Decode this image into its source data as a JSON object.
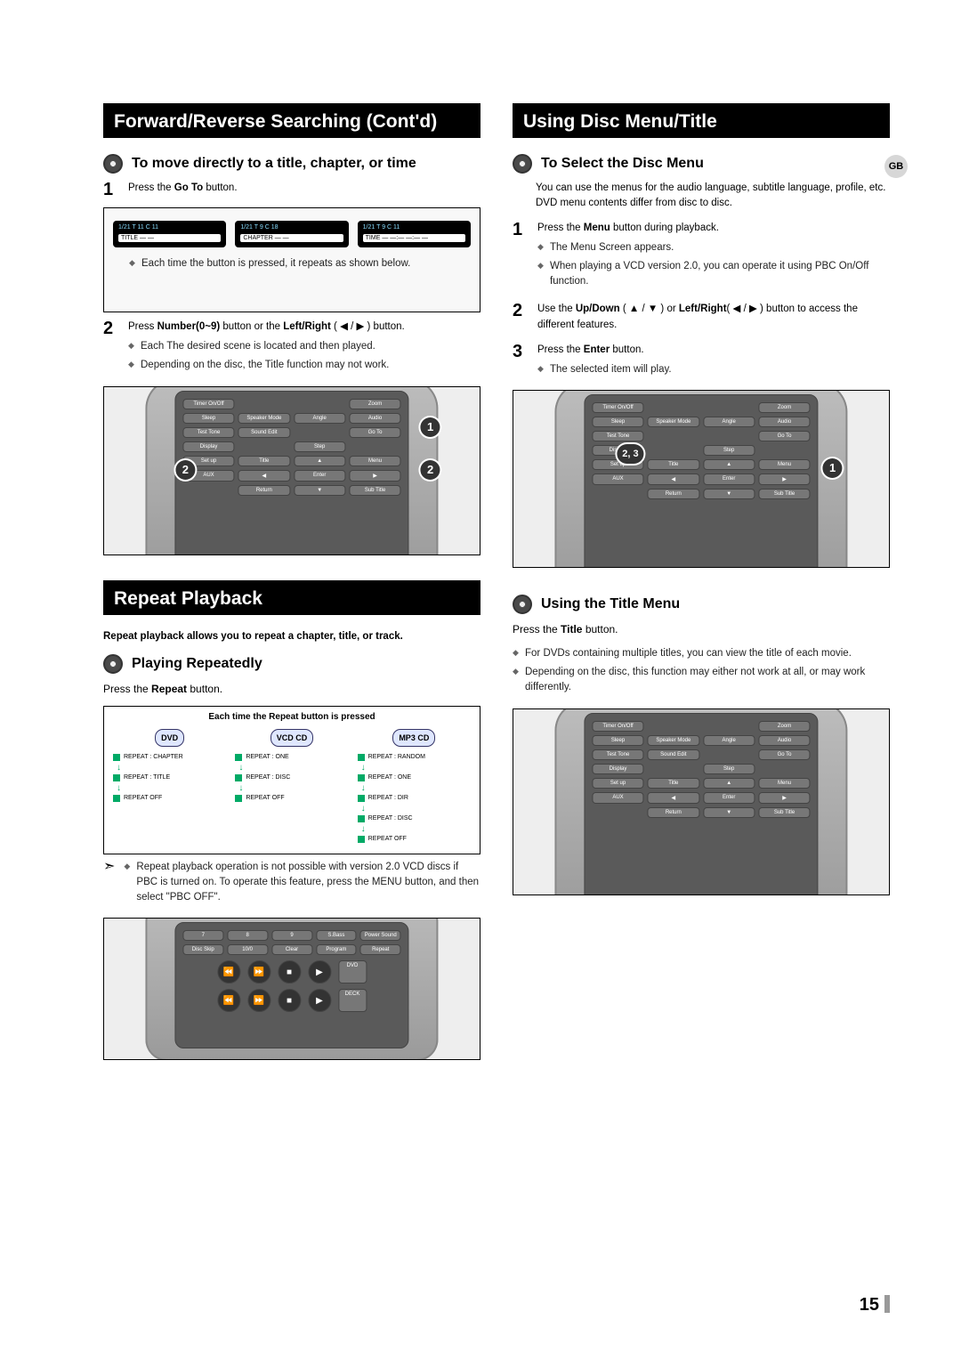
{
  "gb_label": "GB",
  "page_number": "15",
  "left": {
    "band1": "Forward/Reverse Searching (Cont'd)",
    "heading1": "To move directly to a title, chapter, or time",
    "step1_num": "1",
    "step1_text_a": "Press the ",
    "step1_text_bold": "Go To",
    "step1_text_b": " button.",
    "goto_panels": {
      "p1_top": "1/21  T 11  C 11",
      "p1_bot": "TITLE   — —",
      "p2_top": "1/21  T 9  C 18",
      "p2_bot": "CHAPTER — —",
      "p3_top": "1/21  T 9  C 11",
      "p3_bot": "TIME — —:— —:— —"
    },
    "step1_note": "Each time the button is pressed, it repeats as shown below.",
    "step2_num": "2",
    "step2_text_a": "Press ",
    "step2_bold_a": "Number(0~9)",
    "step2_text_b": " button or the ",
    "step2_bold_b": "Left/Right",
    "step2_text_c": " ( ◀ / ▶ ) button.",
    "step2_note1": "Each The desired scene is located and then played.",
    "step2_note2": "Depending on the disc, the Title function may not work.",
    "remote1": {
      "rows": [
        [
          "Timer On/Off",
          "",
          "",
          "Zoom"
        ],
        [
          "Sleep",
          "Speaker Mode",
          "Angle",
          "Audio"
        ],
        [
          "Test Tone",
          "Sound Edit",
          "",
          "Go To"
        ],
        [
          "Display",
          "",
          "Step",
          ""
        ],
        [
          "Set up",
          "Title",
          "▲",
          "Menu"
        ],
        [
          "AUX",
          "◀",
          "Enter",
          "▶"
        ],
        [
          "",
          "Return",
          "▼",
          "Sub Title"
        ]
      ],
      "callouts": {
        "c1": "1",
        "c2a": "2",
        "c2b": "2"
      }
    },
    "band2": "Repeat Playback",
    "intro_bold": "Repeat playback allows you to repeat a chapter, title, or track.",
    "heading2": "Playing Repeatedly",
    "press_repeat_a": "Press the ",
    "press_repeat_bold": "Repeat",
    "press_repeat_b": " button.",
    "repeat_title": "Each time the Repeat button is pressed",
    "repeat_cols": {
      "dvd": {
        "badge": "DVD",
        "states": [
          "REPEAT : CHAPTER",
          "REPEAT : TITLE",
          "REPEAT OFF"
        ]
      },
      "vcdcd": {
        "badge": "VCD CD",
        "states": [
          "REPEAT : ONE",
          "REPEAT : DISC",
          "REPEAT OFF"
        ]
      },
      "mp3": {
        "badge": "MP3  CD",
        "states": [
          "REPEAT : RANDOM",
          "REPEAT : ONE",
          "REPEAT : DIR",
          "REPEAT : DISC",
          "REPEAT OFF"
        ]
      }
    },
    "arrow_note": "Repeat playback operation is not possible with version 2.0 VCD discs if PBC is turned on.\nTo operate this feature, press the MENU button, and then select \"PBC OFF\".",
    "remote2": {
      "top_labels": [
        "7",
        "8",
        "9",
        "S.Bass",
        "Power Sound"
      ],
      "mid_labels": [
        "Disc Skip",
        "10/0",
        "Clear",
        "Program",
        "Repeat"
      ],
      "side_labels": [
        "DVD",
        "DECK"
      ]
    }
  },
  "right": {
    "band1": "Using Disc Menu/Title",
    "heading1": "To Select the Disc Menu",
    "intro": "You can use the menus for the audio language, subtitle language, profile, etc. DVD menu contents differ from disc to disc.",
    "step1_num": "1",
    "step1_a": "Press the ",
    "step1_bold": "Menu",
    "step1_b": " button during playback.",
    "step1_note1": "The Menu Screen appears.",
    "step1_note2": "When playing a VCD version 2.0, you can operate it using PBC On/Off function.",
    "step2_num": "2",
    "step2_a": "Use the ",
    "step2_bold_a": "Up/Down",
    "step2_mid_a": " ( ▲ / ▼ ) or ",
    "step2_bold_b": "Left/Right",
    "step2_mid_b": "( ◀ / ▶ ) button to access the different features.",
    "step3_num": "3",
    "step3_a": "Press the ",
    "step3_bold": "Enter",
    "step3_b": " button.",
    "step3_note": "The selected item will play.",
    "remote1": {
      "rows": [
        [
          "Timer On/Off",
          "",
          "",
          "Zoom"
        ],
        [
          "Sleep",
          "Speaker Mode",
          "Angle",
          "Audio"
        ],
        [
          "Test Tone",
          "",
          "",
          "Go To"
        ],
        [
          "Display",
          "",
          "Step",
          ""
        ],
        [
          "Set up",
          "Title",
          "▲",
          "Menu"
        ],
        [
          "AUX",
          "◀",
          "Enter",
          "▶"
        ],
        [
          "",
          "Return",
          "▼",
          "Sub Title"
        ]
      ],
      "callouts": {
        "c1": "1",
        "c23": "2, 3"
      }
    },
    "heading2": "Using the Title Menu",
    "press_title_a": "Press the ",
    "press_title_bold": "Title",
    "press_title_b": " button.",
    "title_note1": "For DVDs containing multiple titles, you can view the title of each movie.",
    "title_note2": "Depending on the disc, this function may either not work at all, or may work differently.",
    "remote2": {
      "rows": [
        [
          "Timer On/Off",
          "",
          "",
          "Zoom"
        ],
        [
          "Sleep",
          "Speaker Mode",
          "Angle",
          "Audio"
        ],
        [
          "Test Tone",
          "Sound Edit",
          "",
          "Go To"
        ],
        [
          "Display",
          "",
          "Step",
          ""
        ],
        [
          "Set up",
          "Title",
          "▲",
          "Menu"
        ],
        [
          "AUX",
          "◀",
          "Enter",
          "▶"
        ],
        [
          "",
          "Return",
          "▼",
          "Sub Title"
        ]
      ]
    }
  }
}
